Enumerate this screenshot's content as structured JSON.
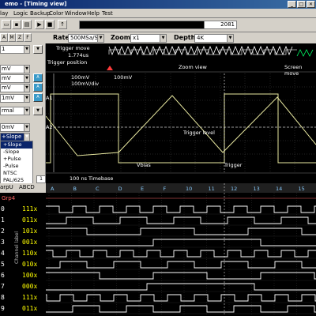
{
  "window": {
    "title": "emo - [Timing view]"
  },
  "menu": [
    "lay",
    "Logic",
    "Backup",
    "Color",
    "Window",
    "Help",
    "Test"
  ],
  "toolbar": {
    "counter": "2081"
  },
  "controls": {
    "rate_label": "Rate",
    "rate_value": "500MSa/S",
    "zoom_label": "Zoom",
    "zoom_value": "x1",
    "depth_label": "Depth",
    "depth_value": "4K",
    "tabs": [
      "A",
      "M",
      "Z",
      "F"
    ]
  },
  "left_panel": {
    "combo1": "1",
    "ch_values": [
      "mV",
      "mV",
      "mV",
      "1mV"
    ],
    "trigger_mode": "rmal",
    "trigger_level": "0mV",
    "trigger_types": [
      "+Slope",
      "-Slope",
      "+Pulse",
      "-Pulse",
      "NTSC",
      "PAL/625"
    ],
    "trigger_selected": 0
  },
  "scope": {
    "trigger_move_label": "Trigger move",
    "trigger_time": "1.774us",
    "trigger_position_label": "Trigger position",
    "zoom_view_label": "Zoom view",
    "screen_move_label": "Screen move",
    "ch1_scale": "100mV",
    "ch2_scale": "100mV/div",
    "ch3_scale": "100mV",
    "marker_a1": "A1",
    "marker_a2": "A2",
    "trigger_level_label": "Trigger level",
    "vbias_label": "Vbias",
    "trigger_label": "Trigger",
    "timebase_value": "100 ns",
    "timebase_label": "Timebase"
  },
  "logic": {
    "header": {
      "grp": "arpU",
      "cols": "ABCD"
    },
    "page": "1",
    "group_label": "Grp4",
    "side_label": "Channel label",
    "ruler": [
      "A",
      "B",
      "C",
      "D",
      "E",
      "F",
      "10",
      "11",
      "12",
      "13",
      "14",
      "15"
    ],
    "rows": [
      {
        "num": "0",
        "bits": "111x"
      },
      {
        "num": "1",
        "bits": "011x"
      },
      {
        "num": "2",
        "bits": "101x"
      },
      {
        "num": "3",
        "bits": "001x"
      },
      {
        "num": "4",
        "bits": "110x"
      },
      {
        "num": "5",
        "bits": "010x"
      },
      {
        "num": "6",
        "bits": "100x"
      },
      {
        "num": "7",
        "bits": "000x"
      },
      {
        "num": "8",
        "bits": "111x"
      },
      {
        "num": "9",
        "bits": "011x"
      }
    ]
  },
  "colors": {
    "trace": "#e8e8a0",
    "grid": "#444444",
    "highlight": "#0a246a",
    "trigger_wave": "#00ff66",
    "marker": "#ff3b3b"
  }
}
